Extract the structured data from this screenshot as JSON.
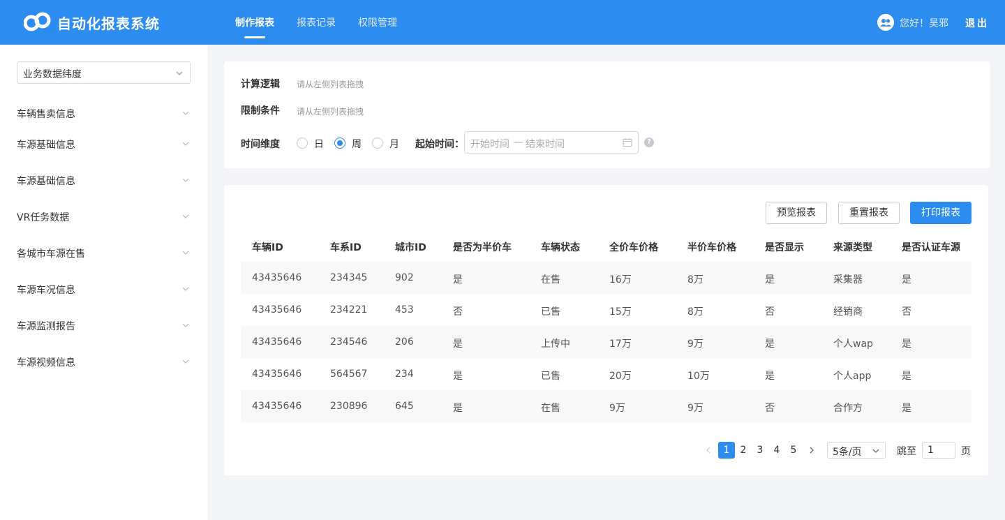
{
  "header": {
    "brand": "自动化报表系统",
    "nav": [
      {
        "label": "制作报表",
        "active": true
      },
      {
        "label": "报表记录",
        "active": false
      },
      {
        "label": "权限管理",
        "active": false
      }
    ],
    "greeting": "您好！吴邪",
    "logout": "退出",
    "accent": "#2d8cf0"
  },
  "sidebar": {
    "select_value": "业务数据纬度",
    "items": [
      "车辆售卖信息",
      "车源基础信息",
      "车源基础信息",
      "VR任务数据",
      "各城市车源在售",
      "车源车况信息",
      "车源监测报告",
      "车源视频信息"
    ]
  },
  "filter": {
    "logic_label": "计算逻辑",
    "logic_hint": "请从左侧列表拖拽",
    "limit_label": "限制条件",
    "limit_hint": "请从左侧列表拖拽",
    "time_label": "时间维度",
    "options": [
      "日",
      "周",
      "月"
    ],
    "selected": "周",
    "start_label": "起始时间：",
    "start_placeholder": "开始时间",
    "separator": "—",
    "end_placeholder": "结束时间"
  },
  "actions": {
    "preview": "预览报表",
    "reset": "重置报表",
    "print": "打印报表"
  },
  "table": {
    "headers": [
      "车辆ID",
      "车系ID",
      "城市ID",
      "是否为半价车",
      "车辆状态",
      "全价车价格",
      "半价车价格",
      "是否显示",
      "来源类型",
      "是否认证车源"
    ],
    "rows": [
      [
        "43435646",
        "234345",
        "902",
        "是",
        "在售",
        "16万",
        "8万",
        "是",
        "采集器",
        "是"
      ],
      [
        "43435646",
        "234221",
        "453",
        "否",
        "已售",
        "15万",
        "8万",
        "否",
        "经销商",
        "否"
      ],
      [
        "43435646",
        "234546",
        "206",
        "是",
        "上传中",
        "17万",
        "9万",
        "是",
        "个人wap",
        "是"
      ],
      [
        "43435646",
        "564567",
        "234",
        "是",
        "已售",
        "20万",
        "10万",
        "是",
        "个人app",
        "是"
      ],
      [
        "43435646",
        "230896",
        "645",
        "是",
        "在售",
        "9万",
        "9万",
        "否",
        "合作方",
        "是"
      ]
    ]
  },
  "pagination": {
    "pages": [
      "1",
      "2",
      "3",
      "4",
      "5"
    ],
    "current": "1",
    "page_size": "5条/页",
    "jump_label": "跳至",
    "jump_value": "1",
    "page_suffix": "页"
  }
}
